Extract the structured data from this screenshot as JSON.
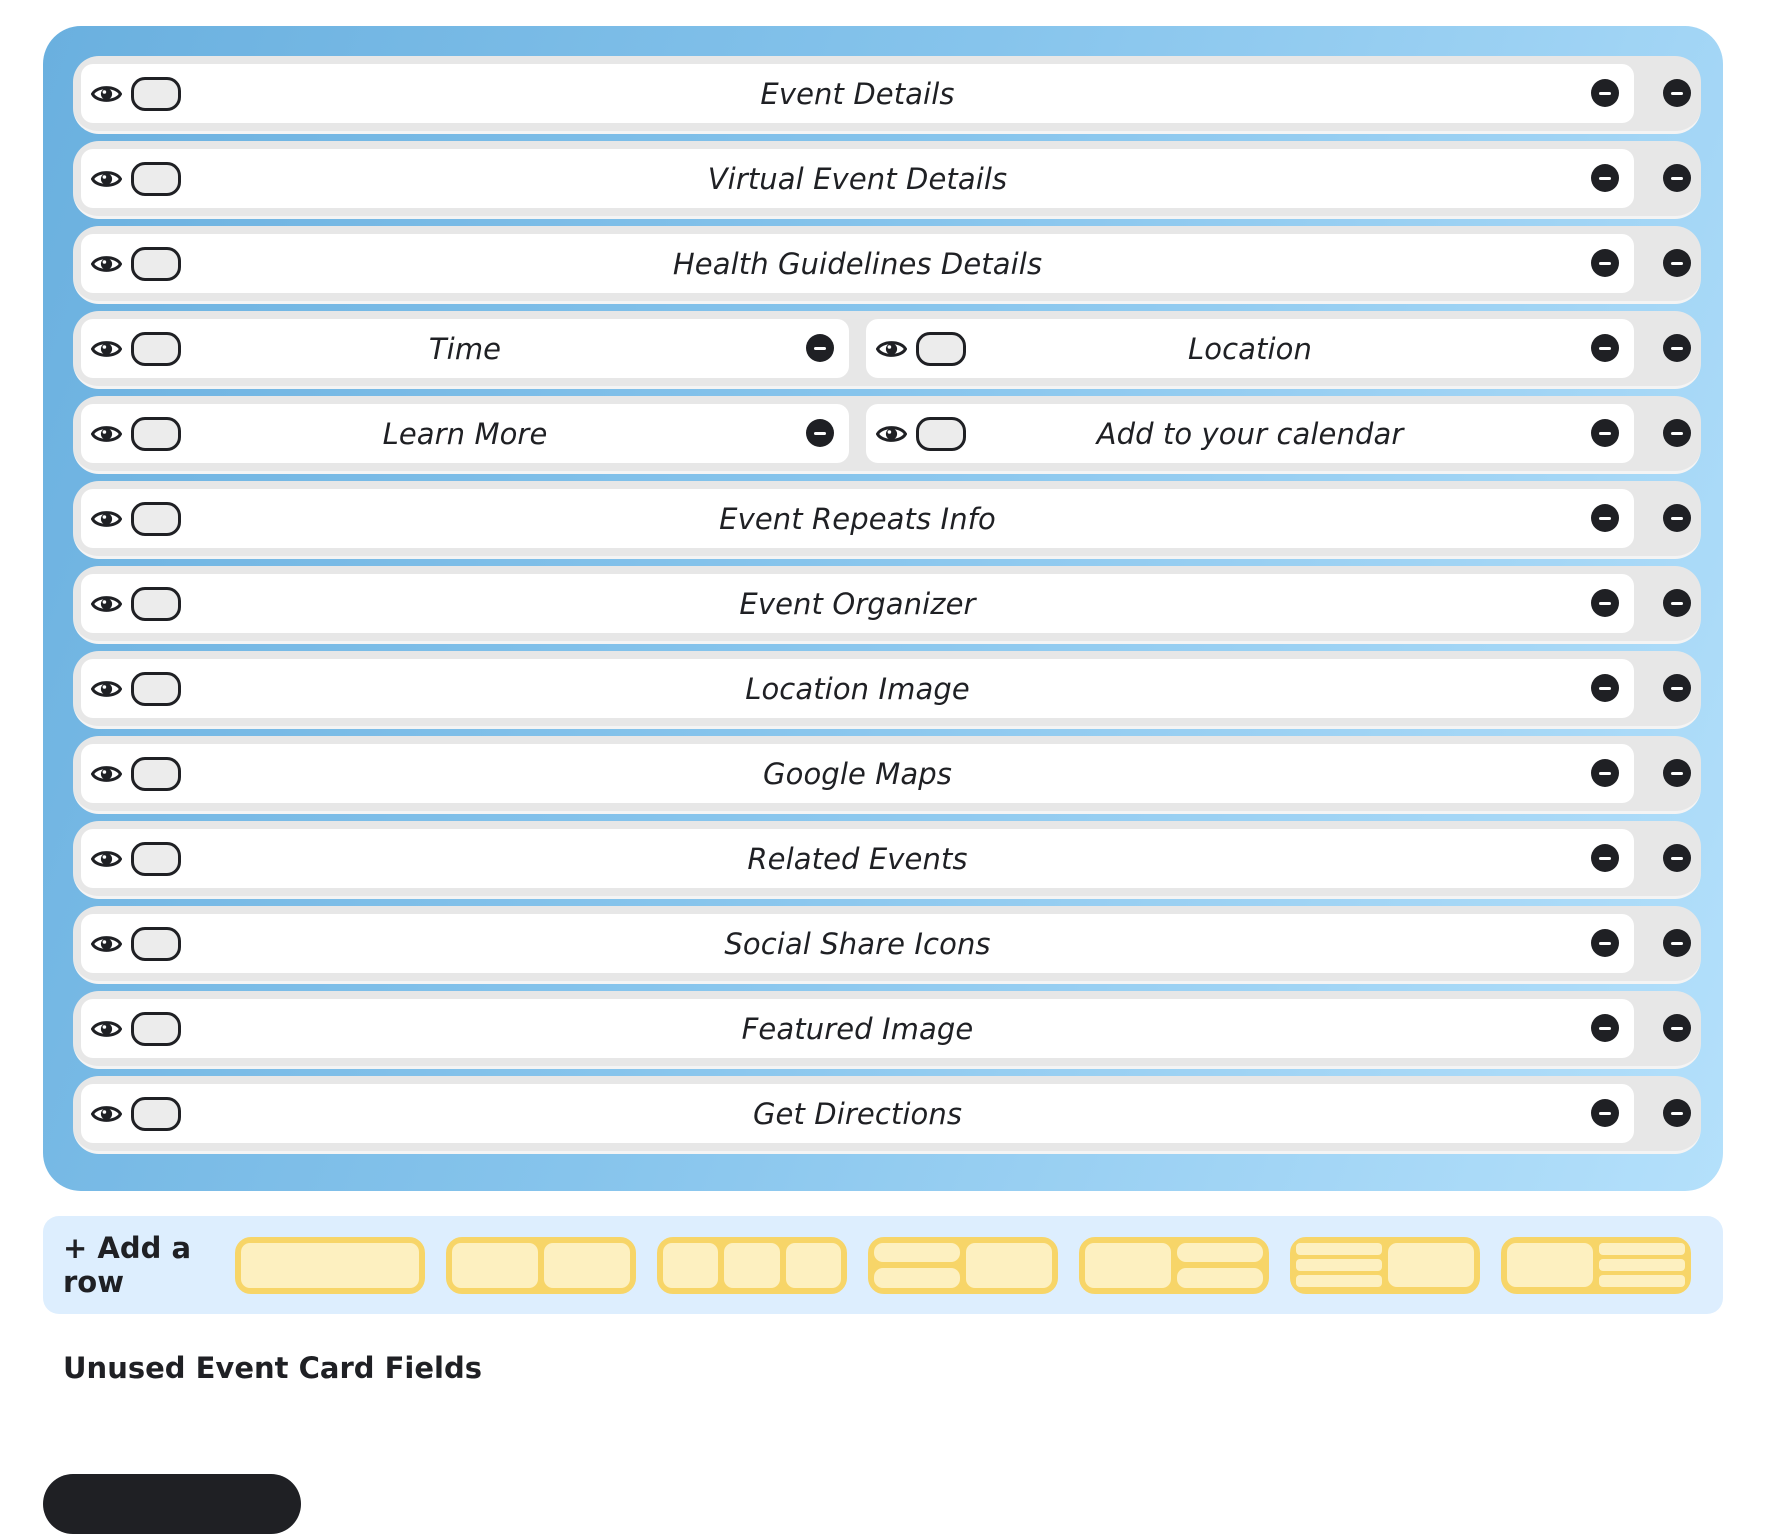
{
  "rows": [
    {
      "cells": [
        "Event Details"
      ]
    },
    {
      "cells": [
        "Virtual Event Details"
      ]
    },
    {
      "cells": [
        "Health Guidelines Details"
      ]
    },
    {
      "cells": [
        "Time",
        "Location"
      ]
    },
    {
      "cells": [
        "Learn More",
        "Add to your calendar"
      ]
    },
    {
      "cells": [
        "Event Repeats Info"
      ]
    },
    {
      "cells": [
        "Event Organizer"
      ]
    },
    {
      "cells": [
        "Location Image"
      ]
    },
    {
      "cells": [
        "Google Maps"
      ]
    },
    {
      "cells": [
        "Related Events"
      ]
    },
    {
      "cells": [
        "Social Share Icons"
      ]
    },
    {
      "cells": [
        "Featured Image"
      ]
    },
    {
      "cells": [
        "Get Directions"
      ]
    }
  ],
  "add_row": {
    "label": "+ Add a row",
    "layouts": [
      "single",
      "two-column",
      "three-column",
      "stacked-left-single-right",
      "single-left-stacked-right",
      "triple-stacked-left-single-right",
      "single-left-triple-stacked-right"
    ]
  },
  "unused_section": {
    "title": "Unused Event Card Fields"
  },
  "icons": {
    "visibility": "eye-icon",
    "toggle": "toggle-switch",
    "remove": "minus-circle-icon"
  },
  "colors": {
    "panel_gradient_start": "#6ab0df",
    "panel_gradient_end": "#b4e0fb",
    "row_background": "#e7e7e7",
    "cell_background": "#ffffff",
    "add_row_bar": "#ddeefe",
    "layout_button": "#f7d568",
    "layout_button_fill": "#fdf0c0",
    "text_dark": "#1f2024"
  }
}
